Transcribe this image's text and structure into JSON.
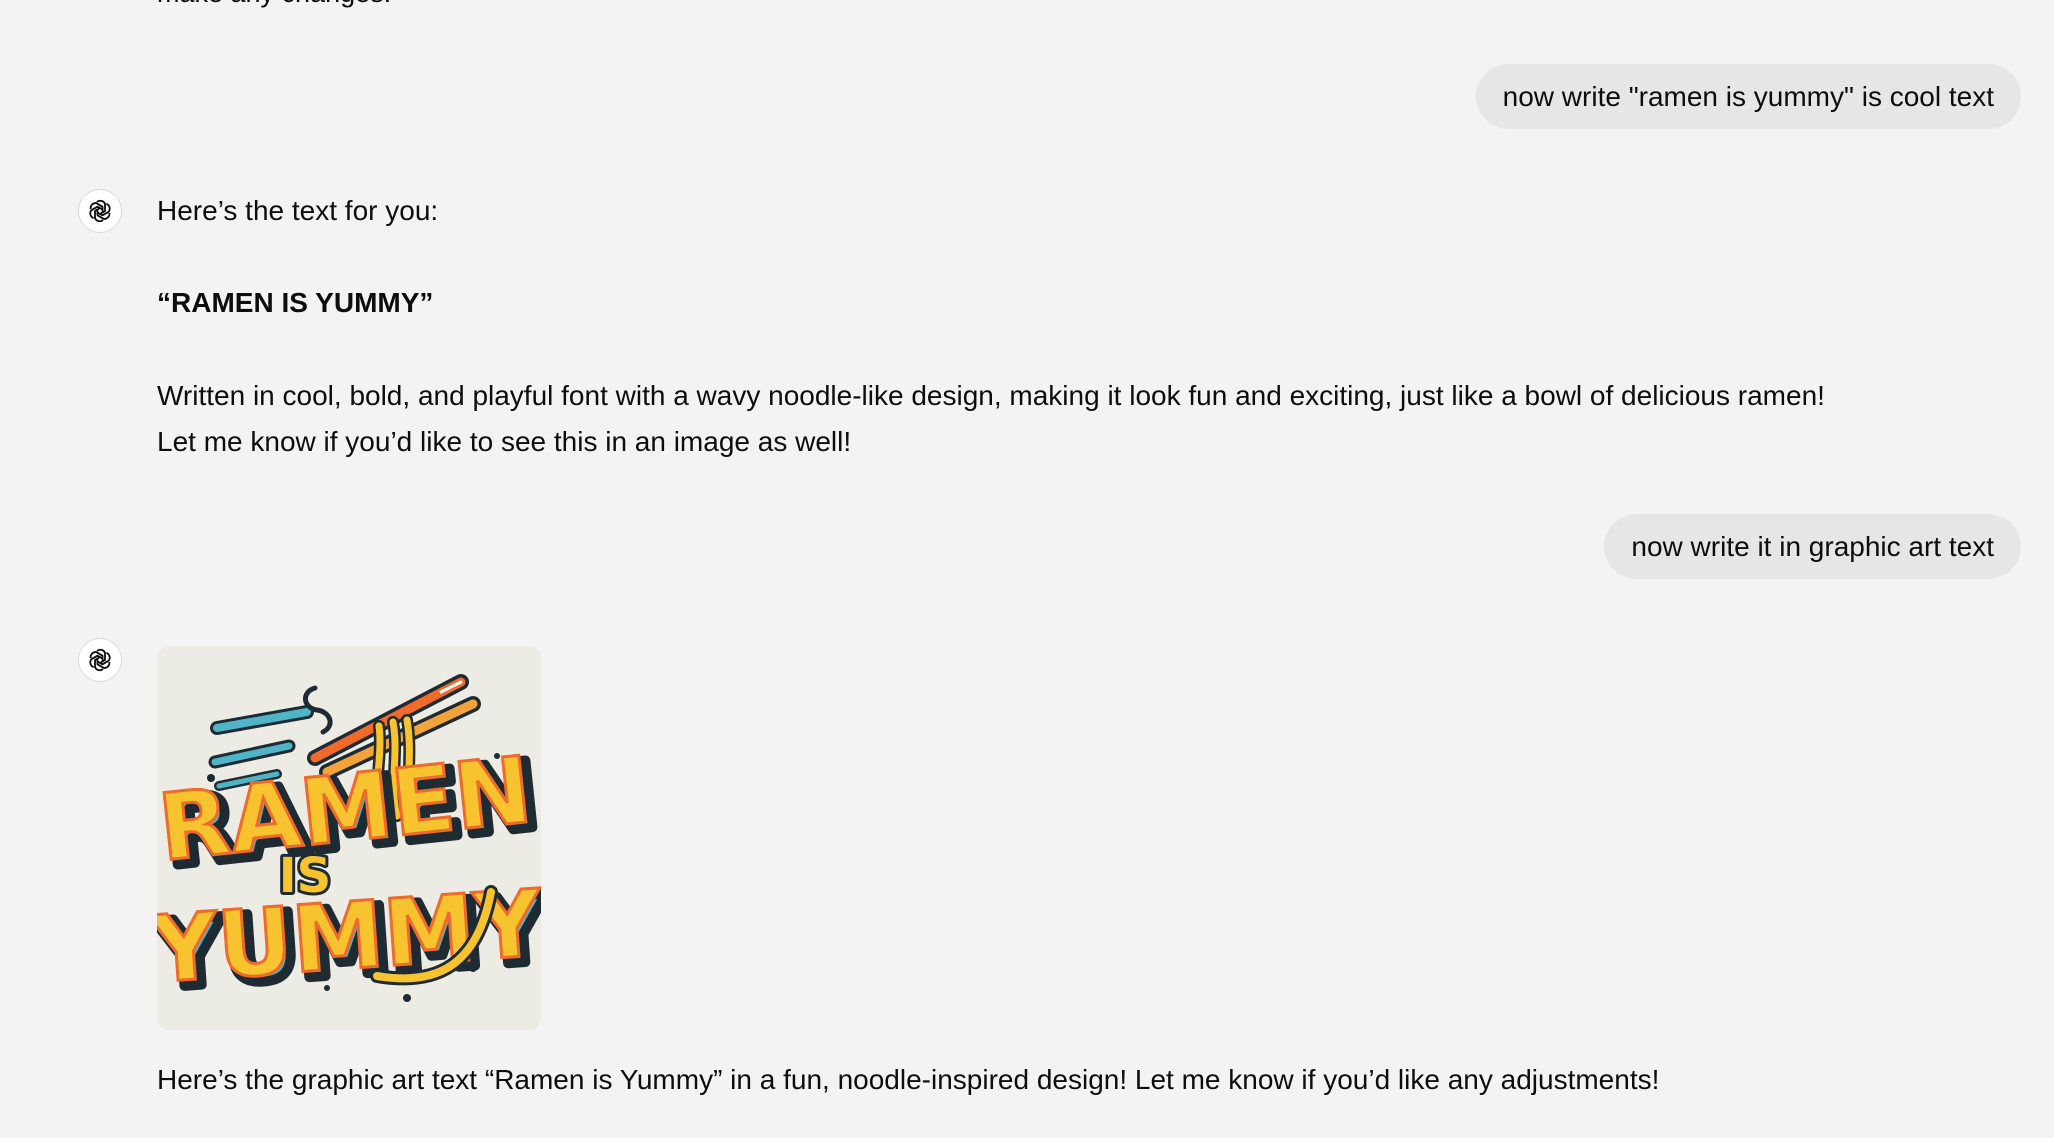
{
  "conversation": {
    "top_fragment": "make any changes.",
    "user_message_1": "now write \"ramen is yummy\" is cool text",
    "assistant_1": {
      "intro": "Here’s the text for you:",
      "bold_text": "“RAMEN IS YUMMY”",
      "paragraph_line_1": "Written in cool, bold, and playful font with a wavy noodle-like design, making it look fun and exciting, just like a bowl of delicious ramen!",
      "paragraph_line_2": "Let me know if you’d like to see this in an image as well!"
    },
    "user_message_2": "now write it in graphic art text",
    "assistant_2": {
      "image": {
        "line1": "RAMEN",
        "line2": "IS",
        "line3": "YUMMY"
      },
      "caption": "Here’s the graphic art text “Ramen is Yummy” in a fun, noodle-inspired design! Let me know if you’d like any adjustments!"
    }
  },
  "icons": {
    "assistant_avatar": "openai-logo-icon"
  },
  "colors": {
    "background": "#f3f3f3",
    "user_bubble": "#e6e6e6",
    "text": "#0d0d0d",
    "art_yellow": "#f7c430",
    "art_orange": "#ef6a2b",
    "art_teal": "#4fb5c6",
    "art_outline": "#1f2b33"
  }
}
